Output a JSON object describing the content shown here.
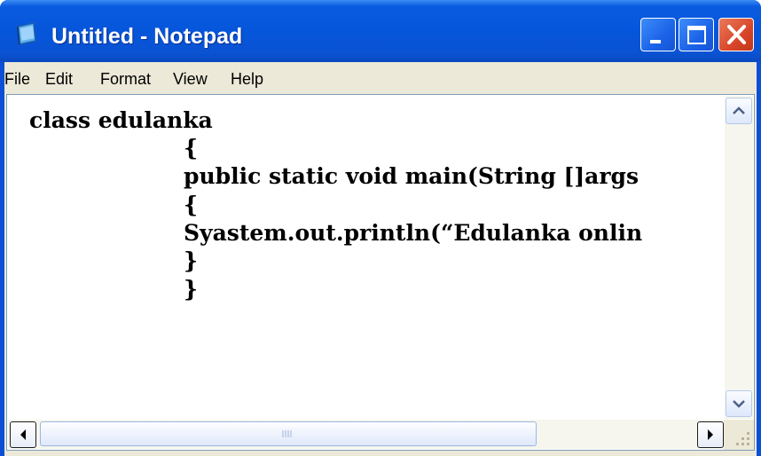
{
  "window": {
    "title": "Untitled - Notepad",
    "icon": "notepad-icon",
    "controls": [
      "minimize-icon",
      "maximize-icon",
      "close-icon"
    ]
  },
  "menu": {
    "file": "File",
    "edit": "Edit",
    "format": "Format",
    "view": "View",
    "help": "Help"
  },
  "editor": {
    "lines": [
      "class edulanka",
      "{",
      "public static void main(String []args",
      "{",
      "Syastem.out.println(“Edulanka onlin",
      "}",
      "}"
    ]
  },
  "scrollbars": {
    "icons": [
      "scroll-up-icon",
      "scroll-down-icon",
      "scroll-left-icon",
      "scroll-right-icon",
      "size-grip-icon"
    ]
  },
  "colors": {
    "title_bar": "#0656db",
    "close_button": "#d9462a",
    "chrome": "#ece9d8",
    "text": "#000000"
  }
}
